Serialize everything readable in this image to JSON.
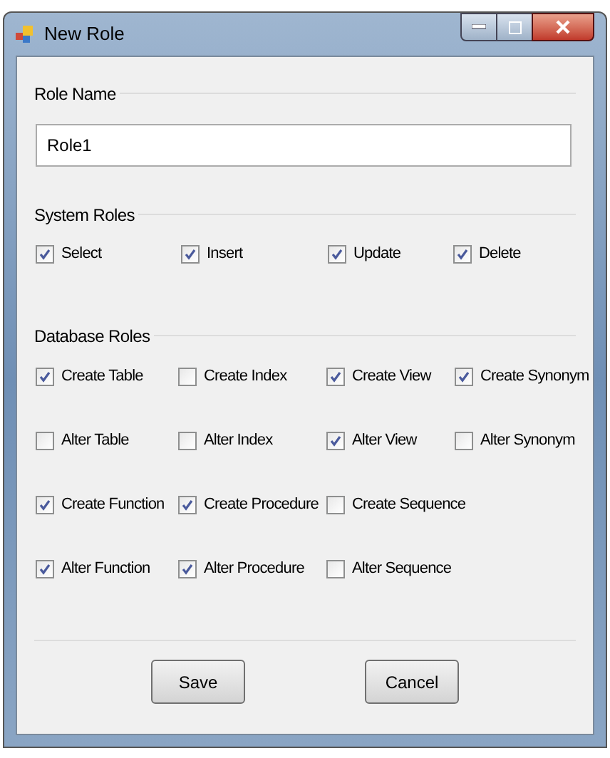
{
  "window": {
    "title": "New Role"
  },
  "role_name": {
    "label": "Role Name",
    "value": "Role1"
  },
  "system_roles": {
    "label": "System Roles",
    "items": [
      {
        "label": "Select",
        "checked": true
      },
      {
        "label": "Insert",
        "checked": true
      },
      {
        "label": "Update",
        "checked": true
      },
      {
        "label": "Delete",
        "checked": true
      }
    ]
  },
  "database_roles": {
    "label": "Database Roles",
    "rows": [
      [
        {
          "label": "Create Table",
          "checked": true
        },
        {
          "label": "Create Index",
          "checked": false
        },
        {
          "label": "Create View",
          "checked": true
        },
        {
          "label": "Create Synonym",
          "checked": true
        }
      ],
      [
        {
          "label": "Alter Table",
          "checked": false
        },
        {
          "label": "Alter Index",
          "checked": false
        },
        {
          "label": "Alter View",
          "checked": true
        },
        {
          "label": "Alter Synonym",
          "checked": false
        }
      ],
      [
        {
          "label": "Create Function",
          "checked": true
        },
        {
          "label": "Create Procedure",
          "checked": true
        },
        {
          "label": "Create Sequence",
          "checked": false
        }
      ],
      [
        {
          "label": "Alter Function",
          "checked": true
        },
        {
          "label": "Alter Procedure",
          "checked": true
        },
        {
          "label": "Alter Sequence",
          "checked": false
        }
      ]
    ]
  },
  "buttons": [
    "Save",
    "Cancel"
  ]
}
